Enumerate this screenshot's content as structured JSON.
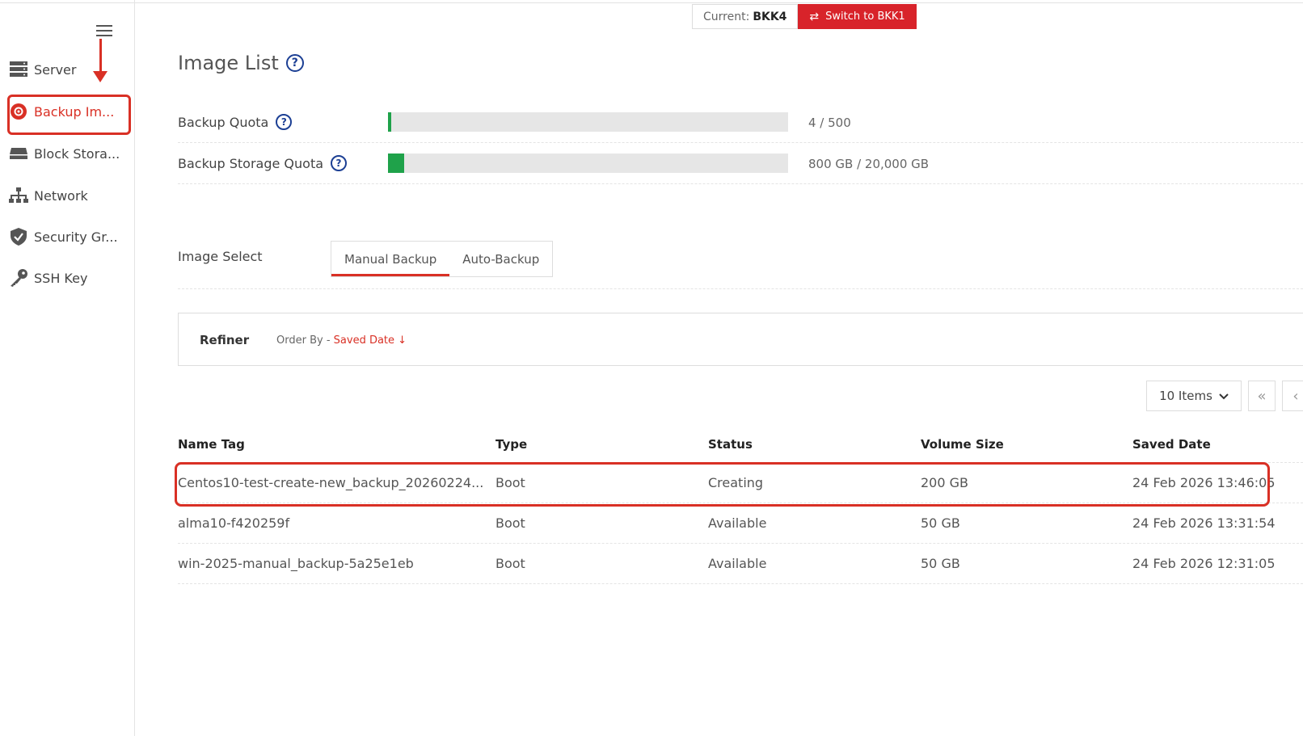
{
  "region": {
    "current_label": "Current:",
    "current_value": "BKK4",
    "switch_label": "Switch to BKK1"
  },
  "sidebar": {
    "items": [
      {
        "label": "Server",
        "icon": "server-icon"
      },
      {
        "label": "Backup Im...",
        "icon": "backup-icon",
        "active": true
      },
      {
        "label": "Block Stora...",
        "icon": "storage-icon"
      },
      {
        "label": "Network",
        "icon": "network-icon"
      },
      {
        "label": "Security Gr...",
        "icon": "shield-icon"
      },
      {
        "label": "SSH Key",
        "icon": "key-icon"
      }
    ]
  },
  "page": {
    "title": "Image List"
  },
  "quotas": [
    {
      "label": "Backup Quota",
      "value": "4 / 500",
      "fraction": 0.008
    },
    {
      "label": "Backup Storage Quota",
      "value": "800 GB / 20,000 GB",
      "fraction": 0.04
    }
  ],
  "image_select": {
    "label": "Image Select",
    "tabs": [
      "Manual Backup",
      "Auto-Backup"
    ],
    "active": "Manual Backup"
  },
  "refiner": {
    "label": "Refiner",
    "order_prefix": "Order By - ",
    "order_value": "Saved Date ↓"
  },
  "pager": {
    "items_label": "10 Items"
  },
  "table": {
    "headers": [
      "Name Tag",
      "Type",
      "Status",
      "Volume Size",
      "Saved Date"
    ],
    "rows": [
      [
        "Centos10-test-create-new_backup_20260224...",
        "Boot",
        "Creating",
        "200 GB",
        "24 Feb 2026 13:46:05"
      ],
      [
        "alma10-f420259f",
        "Boot",
        "Available",
        "50 GB",
        "24 Feb 2026 13:31:54"
      ],
      [
        "win-2025-manual_backup-5a25e1eb",
        "Boot",
        "Available",
        "50 GB",
        "24 Feb 2026 12:31:05"
      ]
    ]
  },
  "colors": {
    "accent": "#d93025",
    "quota_fill": "#1fa24a",
    "help": "#1c3f94"
  }
}
